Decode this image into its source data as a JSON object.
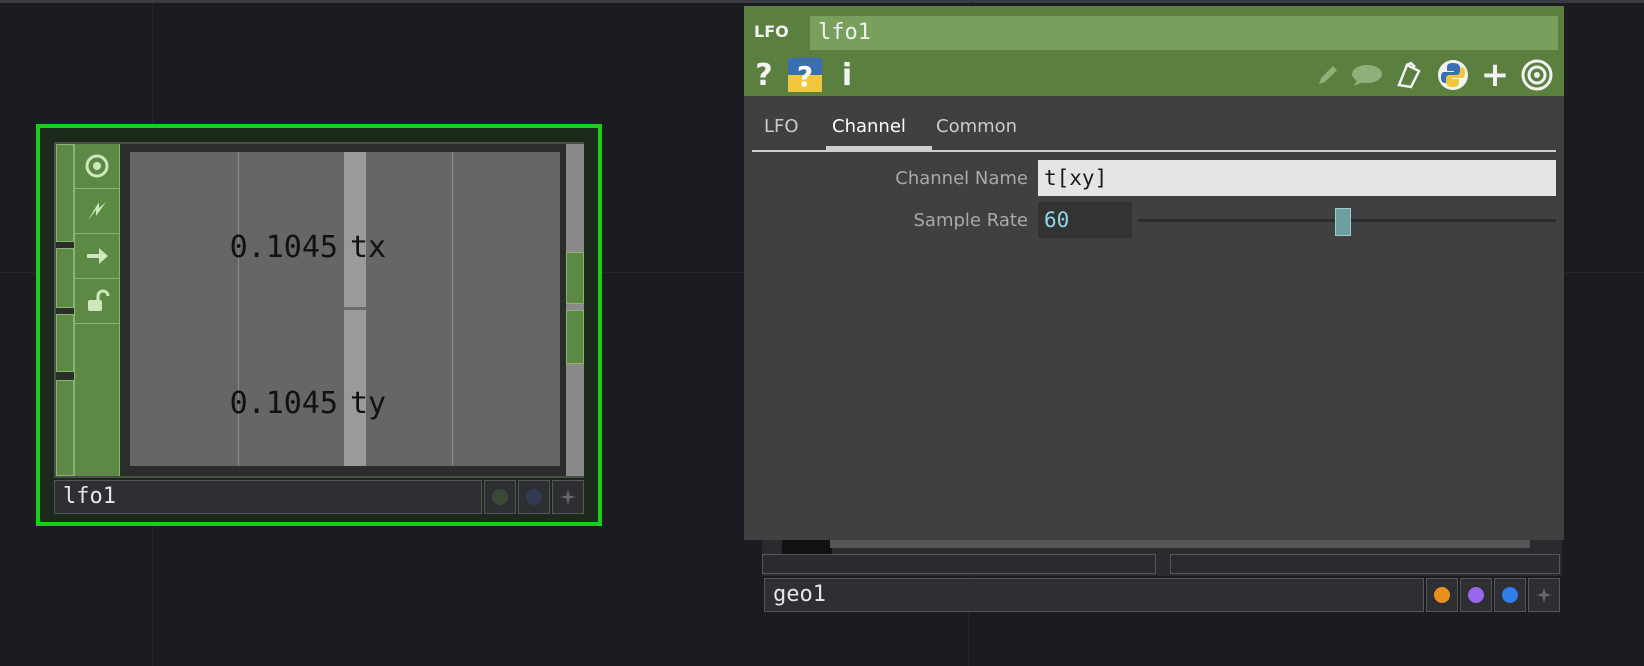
{
  "lfo_node": {
    "name": "lfo1",
    "channels": [
      {
        "value": "0.1045",
        "name": "tx"
      },
      {
        "value": "0.1045",
        "name": "ty"
      }
    ]
  },
  "geo_node": {
    "name": "geo1"
  },
  "panel": {
    "op_type": "LFO",
    "op_name": "lfo1",
    "tabs": [
      "LFO",
      "Channel",
      "Common"
    ],
    "active_tab": "Channel",
    "params": {
      "channel_name_label": "Channel Name",
      "channel_name_value": "t[xy]",
      "sample_rate_label": "Sample Rate",
      "sample_rate_value": "60",
      "sample_rate_slider_fraction": 0.49
    }
  },
  "colors": {
    "node_selected_border": "#17d017",
    "node_green": "#5c8a45",
    "panel_header": "#5a7f3e",
    "sample_rate_text": "#8fd6e6",
    "geo_dot_orange": "#e8901e",
    "geo_dot_purple": "#9a66ee",
    "geo_dot_blue": "#2f7de8"
  }
}
